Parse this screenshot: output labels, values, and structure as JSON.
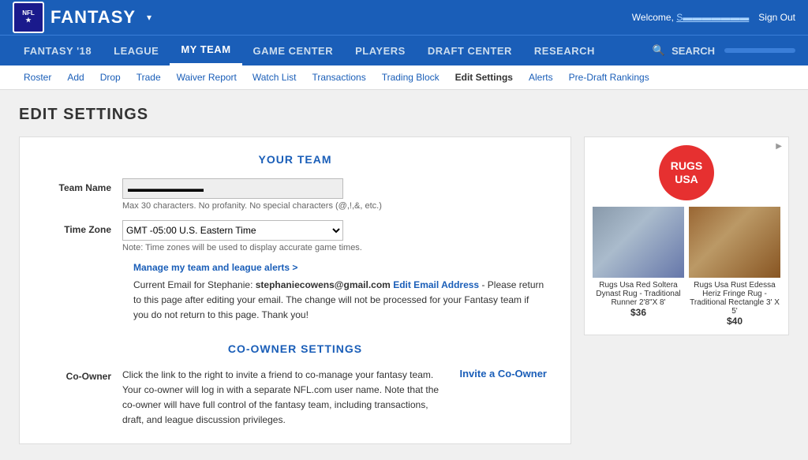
{
  "topbar": {
    "brand": "FANTASY",
    "dropdown_icon": "▾",
    "welcome": "Welcome,",
    "username": "S▬▬▬▬▬▬▬",
    "sign_out": "Sign Out"
  },
  "nav": {
    "items": [
      {
        "label": "FANTASY '18",
        "active": false
      },
      {
        "label": "LEAGUE",
        "active": false
      },
      {
        "label": "MY TEAM",
        "active": true
      },
      {
        "label": "GAME CENTER",
        "active": false
      },
      {
        "label": "PLAYERS",
        "active": false
      },
      {
        "label": "DRAFT CENTER",
        "active": false
      },
      {
        "label": "RESEARCH",
        "active": false
      }
    ],
    "search_label": "SEARCH"
  },
  "subnav": {
    "items": [
      {
        "label": "Roster",
        "active": false
      },
      {
        "label": "Add",
        "active": false
      },
      {
        "label": "Drop",
        "active": false
      },
      {
        "label": "Trade",
        "active": false
      },
      {
        "label": "Waiver Report",
        "active": false
      },
      {
        "label": "Watch List",
        "active": false
      },
      {
        "label": "Transactions",
        "active": false
      },
      {
        "label": "Trading Block",
        "active": false
      },
      {
        "label": "Edit Settings",
        "active": true
      },
      {
        "label": "Alerts",
        "active": false
      },
      {
        "label": "Pre-Draft Rankings",
        "active": false
      }
    ]
  },
  "page": {
    "title": "EDIT SETTINGS"
  },
  "form": {
    "your_team_title": "YOUR TEAM",
    "team_name_label": "Team Name",
    "team_name_value": "▬▬▬▬▬▬▬▬",
    "team_name_hint": "Max 30 characters. No profanity. No special characters (@,!,&, etc.)",
    "timezone_label": "Time Zone",
    "timezone_value": "GMT -05:00 U.S. Eastern Time",
    "timezone_note": "Note: Time zones will be used to display accurate game times.",
    "manage_link": "Manage my team and league alerts >",
    "current_email_label": "Current Email for Stephanie:",
    "email_address": "stephaniecowens@gmail.com",
    "edit_email_link": "Edit Email Address",
    "edit_email_note": "- Please return to this page after editing your email. The change will not be processed for your Fantasy team if you do not return to this page. Thank you!",
    "coowner_title": "CO-OWNER SETTINGS",
    "coowner_label": "Co-Owner",
    "coowner_text": "Click the link to the right to invite a friend to co-manage your fantasy team. Your co-owner will log in with a separate NFL.com user name. Note that the co-owner will have full control of the fantasy team, including transactions, draft, and league discussion privileges.",
    "invite_link": "Invite a Co-Owner"
  },
  "ad": {
    "indicator": "▶",
    "logo_line1": "RUGS",
    "logo_line2": "USA",
    "image1_caption": "Rugs Usa Red Soltera Dynast Rug - Traditional Runner 2'8\"X 8'",
    "image1_price": "$36",
    "image2_caption": "Rugs Usa Rust Edessa Heriz Fringe Rug - Traditional Rectangle 3' X 5'",
    "image2_price": "$40"
  }
}
